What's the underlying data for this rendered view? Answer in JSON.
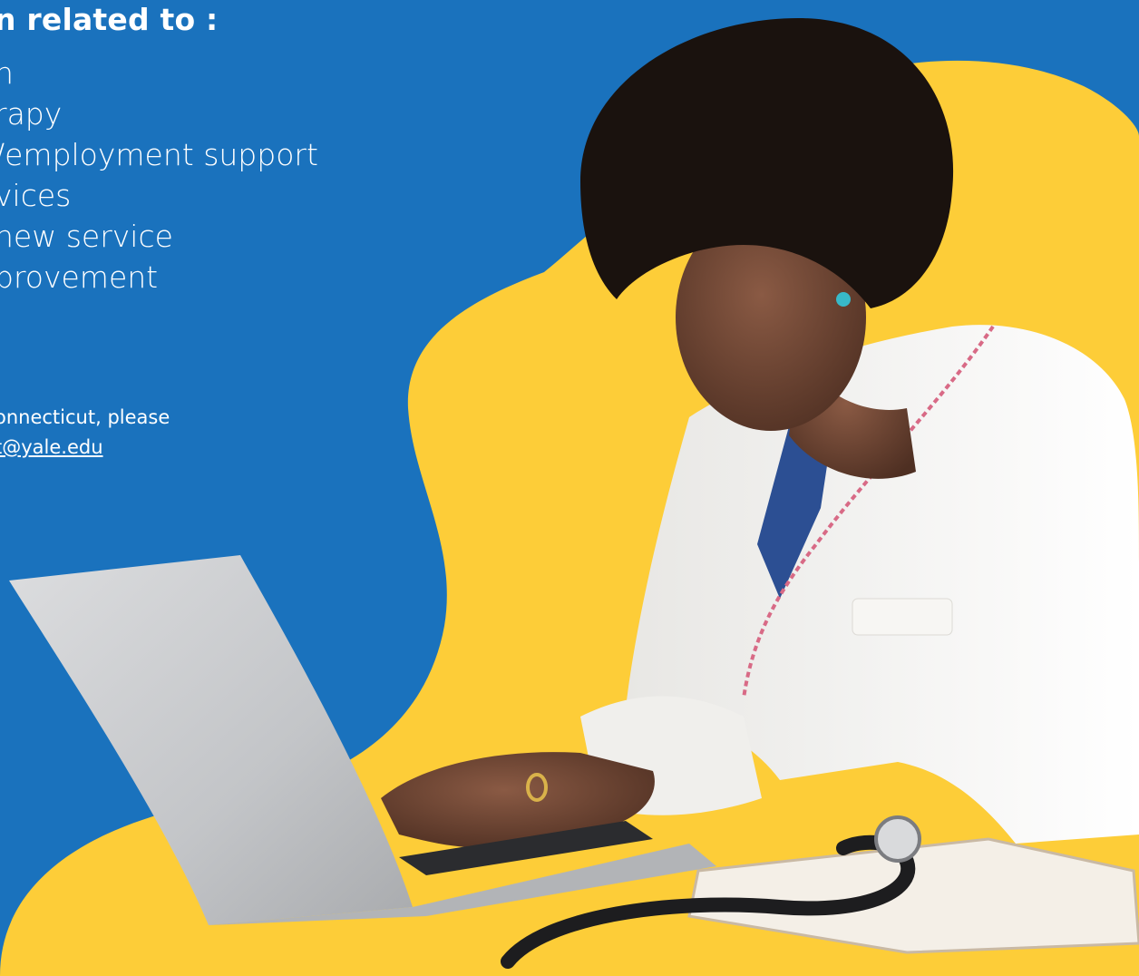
{
  "section": {
    "heading": "n related to :",
    "topics": [
      "n",
      "rapy",
      "/employment support",
      "vices",
      "new service",
      "provement"
    ]
  },
  "contact": {
    "line1": "onnecticut, please",
    "email_text": "t@yale.edu"
  },
  "photo": {
    "subject": "doctor-typing-on-laptop",
    "colors": {
      "background": "#1a72bd",
      "accent_blob": "#fdcd38",
      "coat": "#f2f1ee",
      "laptop": "#c8c9cb"
    }
  }
}
